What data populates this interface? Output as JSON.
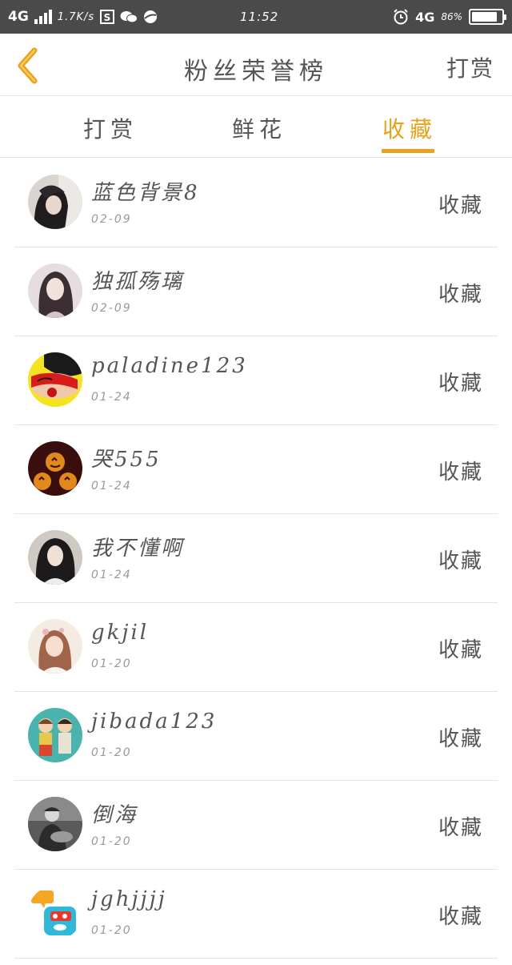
{
  "status_bar": {
    "network": "4G",
    "speed": "1.7K/s",
    "time": "11:52",
    "network_right": "4G",
    "battery": "86%",
    "battery_level": 0.86
  },
  "header": {
    "title": "粉丝荣誉榜",
    "right_action": "打赏"
  },
  "tabs": [
    {
      "label": "打赏",
      "active": false
    },
    {
      "label": "鲜花",
      "active": false
    },
    {
      "label": "收藏",
      "active": true
    }
  ],
  "accent_color": "#e7a21c",
  "fans": [
    {
      "name": "蓝色背景8",
      "date": "02-09",
      "action": "收藏"
    },
    {
      "name": "独孤殇璃",
      "date": "02-09",
      "action": "收藏"
    },
    {
      "name": "paladine123",
      "date": "01-24",
      "action": "收藏"
    },
    {
      "name": "哭555",
      "date": "01-24",
      "action": "收藏"
    },
    {
      "name": "我不懂啊",
      "date": "01-24",
      "action": "收藏"
    },
    {
      "name": "gkjil",
      "date": "01-20",
      "action": "收藏"
    },
    {
      "name": "jibada123",
      "date": "01-20",
      "action": "收藏"
    },
    {
      "name": "倒海",
      "date": "01-20",
      "action": "收藏"
    },
    {
      "name": "jghjjjj",
      "date": "01-20",
      "action": "收藏"
    }
  ]
}
